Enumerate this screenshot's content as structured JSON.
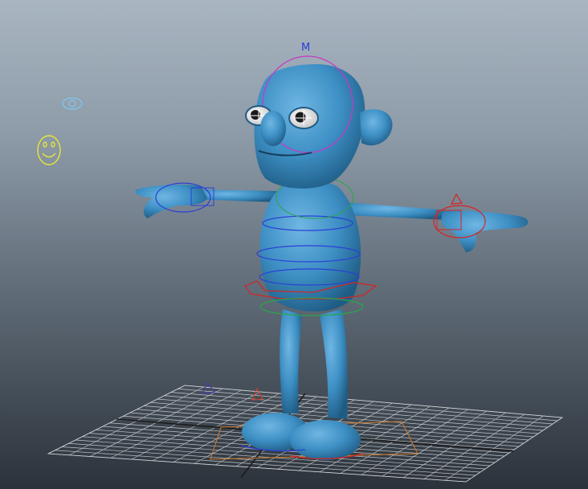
{
  "viewport": {
    "title": "",
    "colors": {
      "background_top": "#a9b6c2",
      "background_bottom": "#2b323a",
      "character_skin": "#3d8fc4",
      "grid_lines": "#d8d8d8",
      "control_blue": "#2a3fd6",
      "control_red": "#d62424",
      "control_green": "#2aa64a",
      "control_magenta": "#c43ac4",
      "eye_control": "#7ec8f0",
      "face_control": "#e6e63a",
      "root_control": "#d27a2a"
    }
  },
  "controls": {
    "head_label": "M",
    "icons": [
      "eye-visibility-control-icon",
      "face-smiley-control-icon",
      "pole-vector-triangle-icon"
    ]
  }
}
